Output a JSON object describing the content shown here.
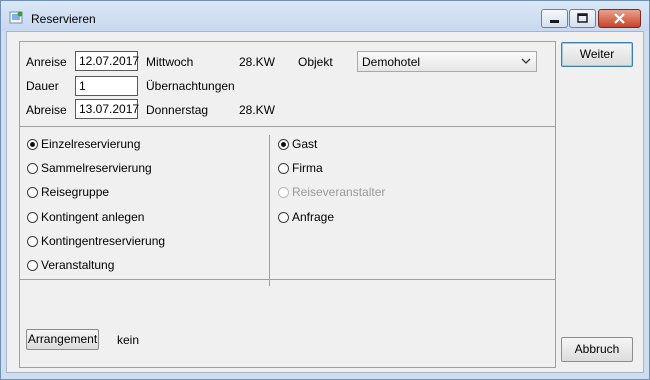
{
  "window": {
    "title": "Reservieren"
  },
  "arrival": {
    "label": "Anreise",
    "date": "12.07.2017",
    "weekday": "Mittwoch",
    "week": "28.KW"
  },
  "object": {
    "label": "Objekt",
    "value": "Demohotel"
  },
  "duration": {
    "label": "Dauer",
    "value": "1",
    "unit": "Übernachtungen"
  },
  "departure": {
    "label": "Abreise",
    "date": "13.07.2017",
    "weekday": "Donnerstag",
    "week": "28.KW"
  },
  "reservation_types": [
    {
      "label": "Einzelreservierung",
      "selected": true
    },
    {
      "label": "Sammelreservierung",
      "selected": false
    },
    {
      "label": "Reisegruppe",
      "selected": false
    },
    {
      "label": "Kontingent anlegen",
      "selected": false
    },
    {
      "label": "Kontingentreservierung",
      "selected": false
    },
    {
      "label": "Veranstaltung",
      "selected": false
    }
  ],
  "guest_types": [
    {
      "label": "Gast",
      "selected": true,
      "enabled": true
    },
    {
      "label": "Firma",
      "selected": false,
      "enabled": true
    },
    {
      "label": "Reiseveranstalter",
      "selected": false,
      "enabled": false
    },
    {
      "label": "Anfrage",
      "selected": false,
      "enabled": true
    }
  ],
  "arrangement": {
    "button_label": "Arrangement",
    "value": "kein"
  },
  "buttons": {
    "next": "Weiter",
    "cancel": "Abbruch"
  },
  "icons": {
    "app": "app-icon",
    "minimize": "minimize-icon",
    "maximize": "maximize-icon",
    "close": "close-icon",
    "dropdown": "chevron-down-icon"
  },
  "colors": {
    "title_bar": "#cfddf0",
    "client_bg": "#f0f0f0",
    "close_button": "#c7432a",
    "default_button_border": "#3c7fb1"
  }
}
